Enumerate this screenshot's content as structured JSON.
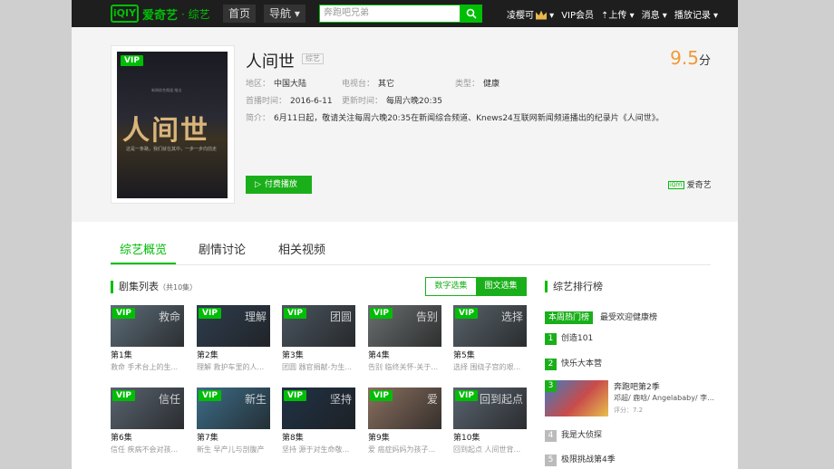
{
  "topbar": {
    "logo_box": "iQIY",
    "logo_name": "爱奇艺",
    "logo_sub": "· 综艺",
    "home": "首页",
    "guide": "导航 ▾",
    "search_placeholder": "奔跑吧兄弟",
    "user": "凌樱可",
    "vip": "VIP会员",
    "upload": "上传",
    "messages": "消息 ▾",
    "history": "播放记录 ▾"
  },
  "show": {
    "poster_title": "人间世",
    "poster_top": "新闻综合频道 推出",
    "poster_sub": "这是一条路，我们就在其中，一步一步向前走",
    "vip": "VIP",
    "title": "人间世",
    "tag": "综艺",
    "score": "9.5",
    "score_unit": "分",
    "region_label": "地区：",
    "region": "中国大陆",
    "station_label": "电视台：",
    "station": "其它",
    "type_label": "类型：",
    "type": "健康",
    "premiere_label": "首播时间：",
    "premiere": "2016-6-11",
    "update_label": "更新时间：",
    "update": "每周六晚20:35",
    "intro_label": "简介：",
    "intro": "6月11日起，敬请关注每周六晚20:35在新闻综合频道、Knews24互联网新闻频道播出的纪录片《人间世》。",
    "play_button": "付费播放",
    "source": "爱奇艺",
    "source_icon": "iQIYI"
  },
  "tabs": [
    "综艺概览",
    "剧情讨论",
    "相关视频"
  ],
  "episodes": {
    "heading": "剧集列表",
    "count": "（共10集）",
    "toggle_numbers": "数字选集",
    "toggle_images": "图文选集",
    "vip": "VIP",
    "items": [
      {
        "num": "第1集",
        "desc": "救命 手术台上的生...",
        "deco": "救命"
      },
      {
        "num": "第2集",
        "desc": "理解 救护车里的人...",
        "deco": "理解"
      },
      {
        "num": "第3集",
        "desc": "团圆 器官捐献-为生...",
        "deco": "团圆"
      },
      {
        "num": "第4集",
        "desc": "告别 临终关怀-关于...",
        "deco": "告别"
      },
      {
        "num": "第5集",
        "desc": "选择 围绕子宫的艰...",
        "deco": "选择"
      },
      {
        "num": "第6集",
        "desc": "信任 疾病不会对孩...",
        "deco": "信任"
      },
      {
        "num": "第7集",
        "desc": "新生 早产儿与剖腹产",
        "deco": "新生"
      },
      {
        "num": "第8集",
        "desc": "坚持 源于对生命敬...",
        "deco": "坚持"
      },
      {
        "num": "第9集",
        "desc": "爱 癌症妈妈为孩子...",
        "deco": "爱"
      },
      {
        "num": "第10集",
        "desc": "回到起点 人间世背...",
        "deco": "回到起点"
      }
    ]
  },
  "ranking": {
    "heading": "综艺排行榜",
    "hot_tab": "本周热门榜",
    "alt_tab": "最受欢迎健康榜",
    "items": [
      {
        "rank": "1",
        "title": "创造101"
      },
      {
        "rank": "2",
        "title": "快乐大本营"
      },
      {
        "rank": "3",
        "title": "奔跑吧第2季",
        "cast": "邓超/ 鹿晗/ Angelababy/ 李...",
        "score": "评分：7.2"
      },
      {
        "rank": "4",
        "title": "我是大侦探"
      },
      {
        "rank": "5",
        "title": "极限挑战第4季"
      }
    ]
  }
}
